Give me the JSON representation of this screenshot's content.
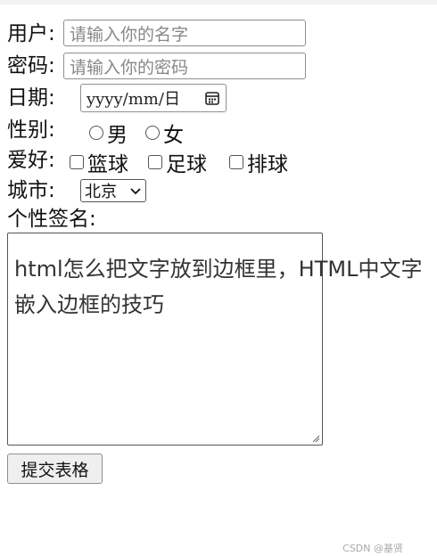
{
  "form": {
    "username": {
      "label": "用户:",
      "placeholder": "请输入你的名字"
    },
    "password": {
      "label": "密码:",
      "placeholder": "请输入你的密码"
    },
    "date": {
      "label": "日期:",
      "placeholder": "yyyy/mm/日"
    },
    "gender": {
      "label": "性别:",
      "options": [
        "男",
        "女"
      ]
    },
    "hobby": {
      "label": "爱好:",
      "options": [
        "篮球",
        "足球",
        "排球"
      ]
    },
    "city": {
      "label": "城市:",
      "selected": "北京"
    },
    "signature": {
      "label": "个性签名:"
    },
    "submit_label": "提交表格"
  },
  "overlay": {
    "title_text": "html怎么把文字放到边框里，HTML中文字嵌入边框的技巧",
    "credit": "CSDN @基贤"
  },
  "icons": {
    "date": "calendar-icon",
    "select": "chevron-down-icon",
    "textarea": "resize-handle-icon"
  }
}
